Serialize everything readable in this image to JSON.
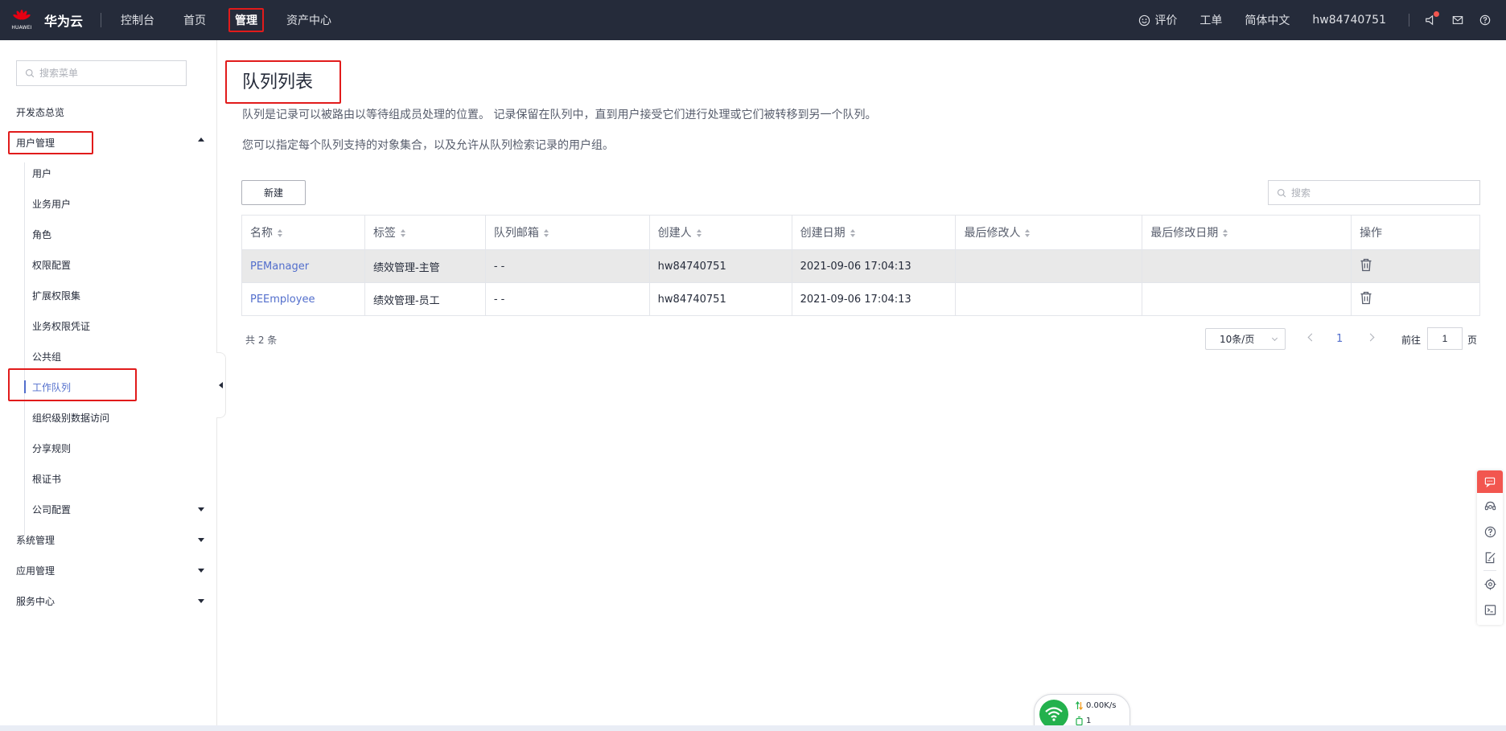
{
  "header": {
    "brand": "华为云",
    "logo_text": "HUAWEI",
    "nav": [
      "控制台",
      "首页",
      "管理",
      "资产中心"
    ],
    "active_nav": "管理",
    "feedback": "评价",
    "ticket": "工单",
    "language": "简体中文",
    "username": "hw84740751"
  },
  "sidebar": {
    "search_placeholder": "搜索菜单",
    "overview": "开发态总览",
    "user_mgmt": "用户管理",
    "sub_items": [
      "用户",
      "业务用户",
      "角色",
      "权限配置",
      "扩展权限集",
      "业务权限凭证",
      "公共组",
      "工作队列",
      "组织级别数据访问",
      "分享规则",
      "根证书",
      "公司配置"
    ],
    "active_item": "工作队列",
    "system_mgmt": "系统管理",
    "app_mgmt": "应用管理",
    "service_center": "服务中心"
  },
  "main": {
    "title": "队列列表",
    "desc1": "队列是记录可以被路由以等待组成员处理的位置。 记录保留在队列中，直到用户接受它们进行处理或它们被转移到另一个队列。",
    "desc2": "您可以指定每个队列支持的对象集合，以及允许从队列检索记录的用户组。",
    "new_button": "新建",
    "search_placeholder": "搜索",
    "columns": [
      "名称",
      "标签",
      "队列邮箱",
      "创建人",
      "创建日期",
      "最后修改人",
      "最后修改日期",
      "操作"
    ],
    "rows": [
      {
        "name": "PEManager",
        "label": "绩效管理-主管",
        "email": "- -",
        "creator": "hw84740751",
        "created": "2021-09-06 17:04:13",
        "modifier": "",
        "modified": ""
      },
      {
        "name": "PEEmployee",
        "label": "绩效管理-员工",
        "email": "- -",
        "creator": "hw84740751",
        "created": "2021-09-06 17:04:13",
        "modifier": "",
        "modified": ""
      }
    ],
    "total": "共 2 条",
    "page_size": "10条/页",
    "current_page": "1",
    "goto_label": "前往",
    "goto_value": "1",
    "page_unit": "页"
  },
  "network": {
    "speed": "0.00K/s",
    "count": "1"
  },
  "colors": {
    "topbar": "#252b3a",
    "link": "#526ecc",
    "highlight": "#e11b1b",
    "float_top": "#f2564f",
    "wifi": "#23b14d"
  }
}
